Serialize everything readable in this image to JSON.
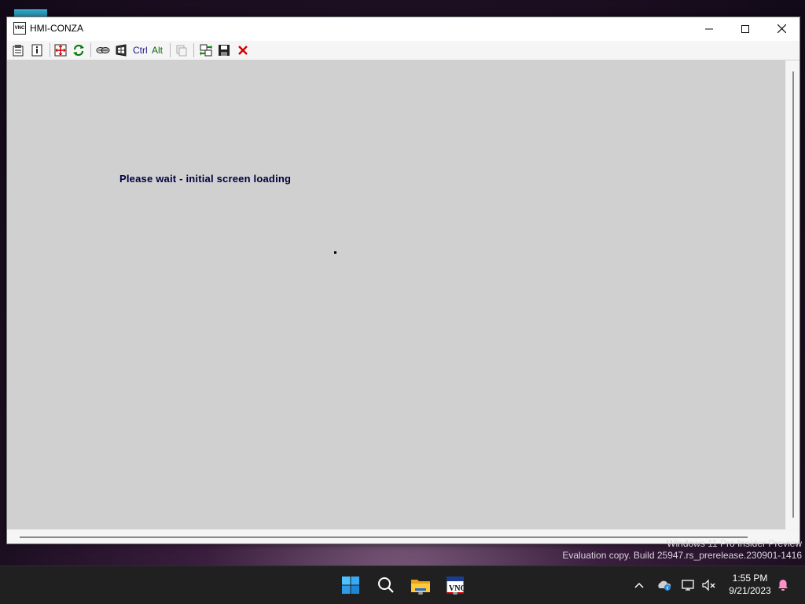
{
  "window": {
    "title": "HMI-CONZA",
    "app_icon_text": "VNC",
    "controls": [
      "minimize",
      "maximize",
      "close"
    ]
  },
  "toolbar": {
    "buttons": [
      {
        "icon": "options-icon"
      },
      {
        "icon": "connection-info-icon"
      },
      {
        "icon": "fullscreen-icon"
      },
      {
        "icon": "refresh-icon"
      },
      {
        "icon": "ctrl-alt-del-icon"
      },
      {
        "icon": "start-menu-icon"
      },
      {
        "label": "Ctrl"
      },
      {
        "label": "Alt"
      },
      {
        "icon": "copy-disabled-icon"
      },
      {
        "icon": "transfer-files-icon"
      },
      {
        "icon": "save-icon"
      },
      {
        "icon": "disconnect-icon"
      }
    ]
  },
  "remote": {
    "message": "Please wait - initial screen loading",
    "background": "#d0d0d0"
  },
  "watermark": {
    "line1": "Windows 11 Pro Insider Preview",
    "line2": "Evaluation copy. Build 25947.rs_prerelease.230901-1416"
  },
  "taskbar": {
    "apps": [
      "start-icon",
      "search-icon",
      "file-explorer-icon",
      "vnc-viewer-icon"
    ],
    "tray": [
      "show-hidden-icons-chevron",
      "onedrive-icon",
      "network-icon",
      "volume-muted-icon",
      "notifications-icon"
    ],
    "time": "1:55 PM",
    "date": "9/21/2023"
  }
}
